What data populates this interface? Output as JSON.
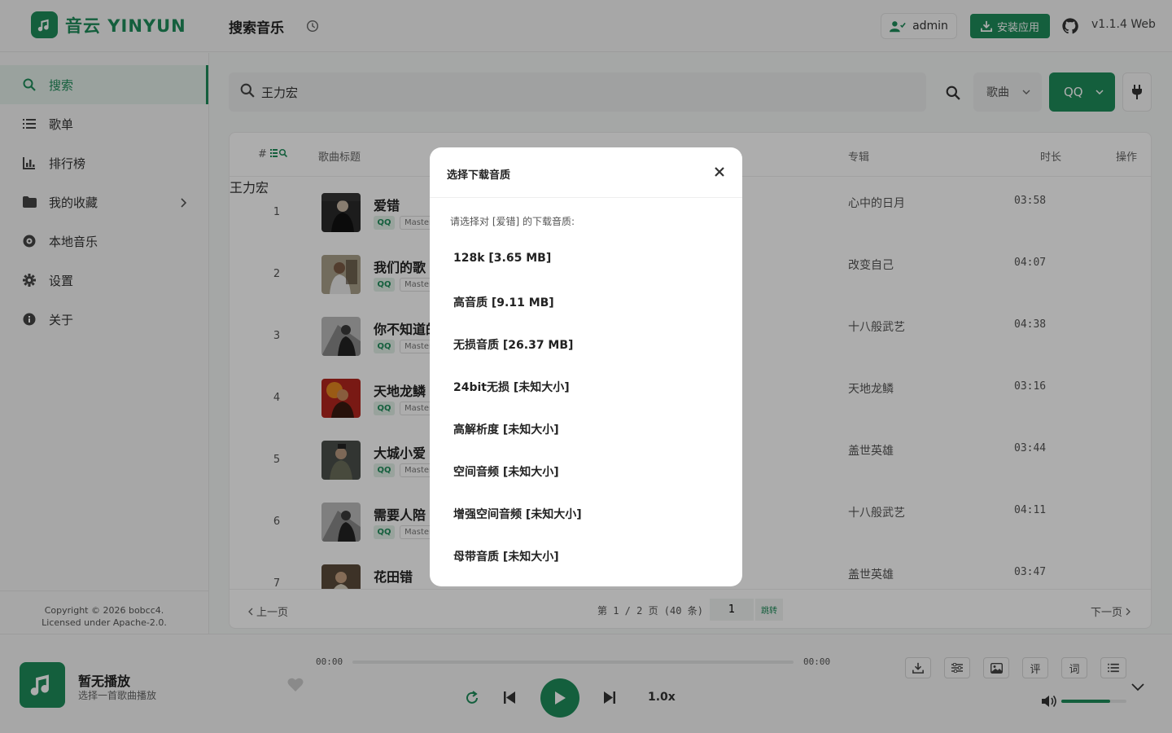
{
  "brand": {
    "name": "音云 YINYUN",
    "color": "#1e8c5a"
  },
  "header": {
    "page_title": "搜索音乐",
    "user_label": "admin",
    "install_label": "安装应用",
    "version": "v1.1.4 Web"
  },
  "sidebar": {
    "items": [
      {
        "label": "搜索",
        "icon": "search-icon"
      },
      {
        "label": "歌单",
        "icon": "list-icon"
      },
      {
        "label": "排行榜",
        "icon": "chart-icon"
      },
      {
        "label": "我的收藏",
        "icon": "folder-icon"
      },
      {
        "label": "本地音乐",
        "icon": "disc-icon"
      },
      {
        "label": "设置",
        "icon": "gear-icon"
      },
      {
        "label": "关于",
        "icon": "info-icon"
      }
    ],
    "copyright_line1": "Copyright © 2026 bobcc4.",
    "copyright_line2": "Licensed under Apache-2.0."
  },
  "search": {
    "value": "王力宏",
    "type": "歌曲",
    "source": "QQ"
  },
  "table": {
    "headers": {
      "num": "#",
      "title": "歌曲标题",
      "album": "专辑",
      "duration": "时长",
      "ops": "操作"
    },
    "source_tag": "QQ",
    "quality_tag": "Master",
    "rows": [
      {
        "num": "1",
        "title": "爱错",
        "album": "心中的日月",
        "duration": "03:58"
      },
      {
        "num": "2",
        "title": "我们的歌",
        "album": "改变自己",
        "duration": "04:07"
      },
      {
        "num": "3",
        "title": "你不知道的事",
        "album": "十八般武艺",
        "duration": "04:38"
      },
      {
        "num": "4",
        "title": "天地龙鳞",
        "album": "天地龙鳞",
        "duration": "03:16"
      },
      {
        "num": "5",
        "title": "大城小爱",
        "album": "盖世英雄",
        "duration": "03:44"
      },
      {
        "num": "6",
        "title": "需要人陪",
        "album": "十八般武艺",
        "duration": "04:11"
      },
      {
        "num": "7",
        "title": "花田错",
        "album": "盖世英雄",
        "duration": "03:47"
      }
    ],
    "partial_artist": "王力宏"
  },
  "pager": {
    "prev": "上一页",
    "info": "第 1 / 2 页 (40 条)",
    "page_value": "1",
    "jump": "跳转",
    "next": "下一页"
  },
  "player": {
    "title": "暂无播放",
    "subtitle": "选择一首歌曲播放",
    "time_current": "00:00",
    "time_total": "00:00",
    "speed": "1.0x",
    "comment_label": "评",
    "lyric_label": "词",
    "volume": 0.75
  },
  "modal": {
    "title": "选择下载音质",
    "description": "请选择对 [爱错] 的下载音质:",
    "options": [
      "128k [3.65 MB]",
      "高音质 [9.11 MB]",
      "无损音质 [26.37 MB]",
      "24bit无损 [未知大小]",
      "高解析度 [未知大小]",
      "空间音频 [未知大小]",
      "增强空间音频 [未知大小]",
      "母带音质 [未知大小]"
    ]
  }
}
